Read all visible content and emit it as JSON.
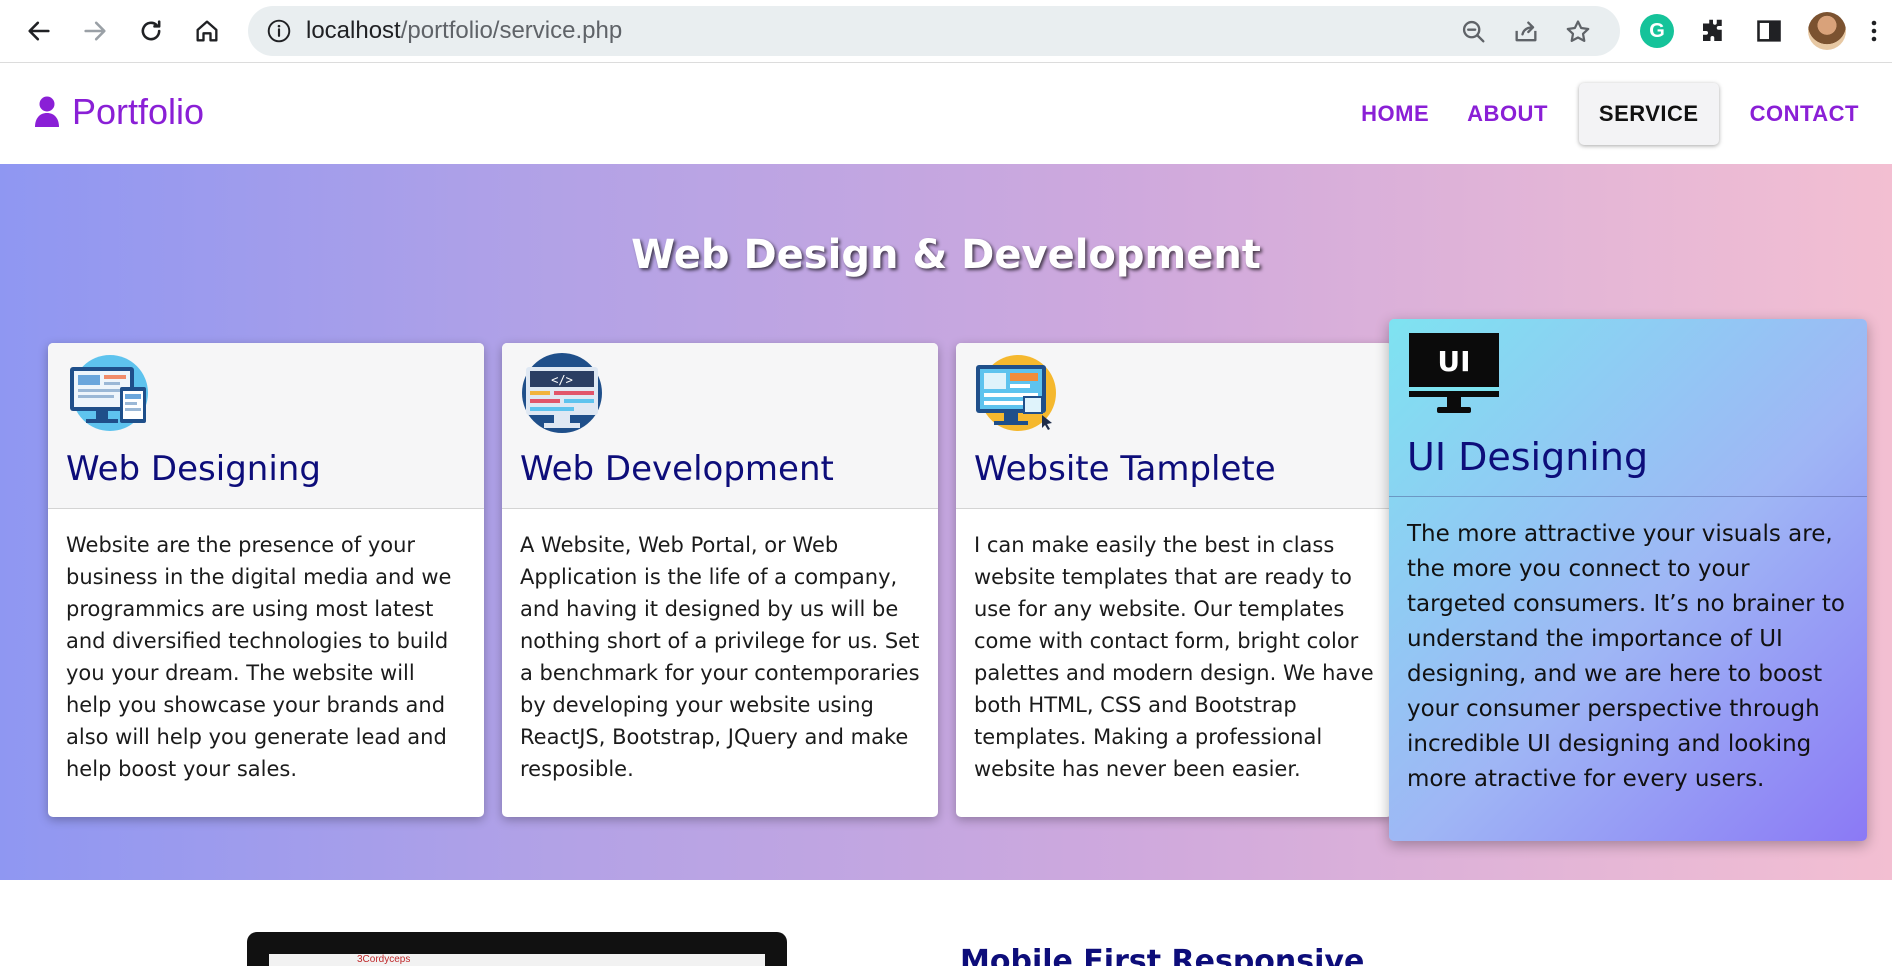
{
  "browser": {
    "url_host": "localhost",
    "url_path": "/portfolio/service.php",
    "extension_grammarly_letter": "G"
  },
  "site": {
    "brand": "Portfolio",
    "brand_color": "#8a1fd6",
    "nav": [
      {
        "label": "HOME",
        "active": false
      },
      {
        "label": "ABOUT",
        "active": false
      },
      {
        "label": "SERVICE",
        "active": true
      },
      {
        "label": "CONTACT",
        "active": false
      }
    ]
  },
  "hero": {
    "title": "Web Design & Development"
  },
  "services": [
    {
      "title": "Web Designing",
      "icon": "monitor-design-icon",
      "body": "Website are the presence of your business in the digital media and we programmics are using most latest and diversified technologies to build you your dream. The website will help you showcase your brands and also will help you generate lead and help boost your sales."
    },
    {
      "title": "Web Development",
      "icon": "code-monitor-icon",
      "body": "A Website, Web Portal, or Web Application is the life of a company, and having it designed by us will be nothing short of a privilege for us. Set a benchmark for your contemporaries by developing your website using ReactJS, Bootstrap, JQuery and make resposible."
    },
    {
      "title": "Website Tamplete",
      "icon": "template-monitor-icon",
      "body": "I can make easily the best in class website templates that are ready to use for any website. Our templates come with contact form, bright color palettes and modern design. We have both HTML, CSS and Bootstrap templates. Making a professional website has never been easier."
    },
    {
      "title": "UI Designing",
      "icon": "ui-monitor-icon",
      "icon_text": "UI",
      "body": "The more attractive your visuals are, the more you connect to your targeted consumers. It’s no brainer to understand the importance of UI designing, and we are here to boost your consumer perspective through incredible UI designing and looking more atractive for every users."
    }
  ],
  "below": {
    "laptop_brand": "3Cordyceps",
    "heading": "Mobile First Responsive"
  }
}
